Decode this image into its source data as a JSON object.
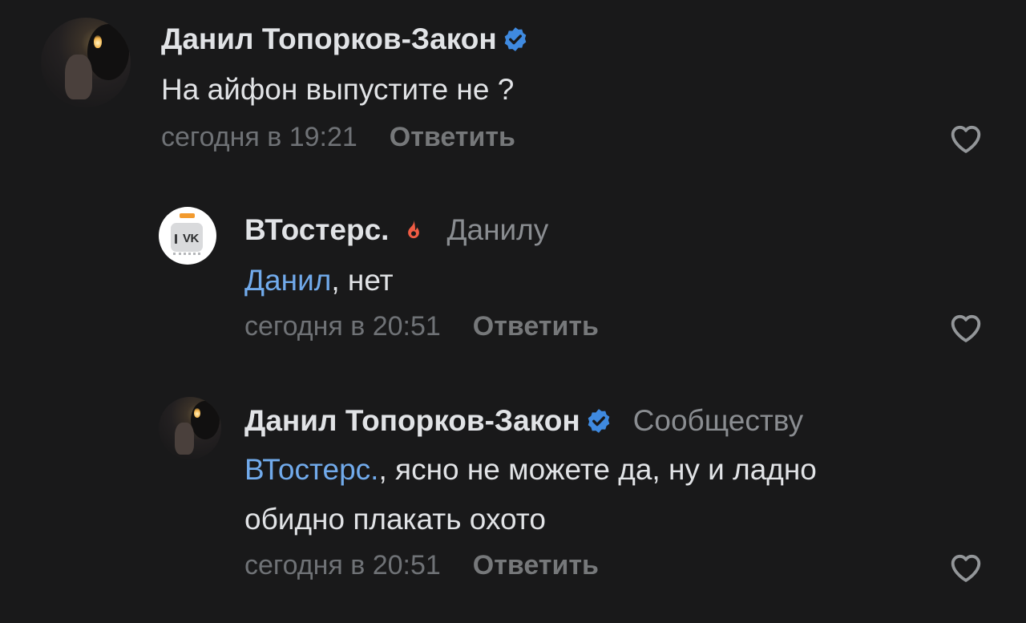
{
  "comments": [
    {
      "author": "Данил Топорков-Закон",
      "verified": true,
      "reply_to": "",
      "mention": "",
      "text_lines": [
        "На айфон выпустите не ?"
      ],
      "timestamp": "сегодня в 19:21",
      "reply_label": "Ответить",
      "avatar": "user-photo-avatar"
    },
    {
      "author": "ВТостерс.",
      "fire_badge": true,
      "reply_to": "Данилу",
      "mention": "Данил",
      "text_lines": [
        ", нет"
      ],
      "timestamp": "сегодня в 20:51",
      "reply_label": "Ответить",
      "avatar": "toaster-vk-avatar"
    },
    {
      "author": "Данил Топорков-Закон",
      "verified": true,
      "reply_to": "Сообществу",
      "mention": "ВТостерс.",
      "text_lines": [
        ", ясно не можете да, ну и ладно",
        "обидно плакать охото"
      ],
      "timestamp": "сегодня в 20:51",
      "reply_label": "Ответить",
      "avatar": "user-photo-avatar"
    }
  ],
  "colors": {
    "background": "#19191a",
    "text": "#e1e3e6",
    "secondary": "#8a8d91",
    "link": "#71aaeb",
    "verified": "#3f8ae0",
    "fire": "#f05c44"
  },
  "icons": {
    "verified": "verified-check-icon",
    "fire": "fire-icon",
    "like": "heart-outline-icon"
  }
}
